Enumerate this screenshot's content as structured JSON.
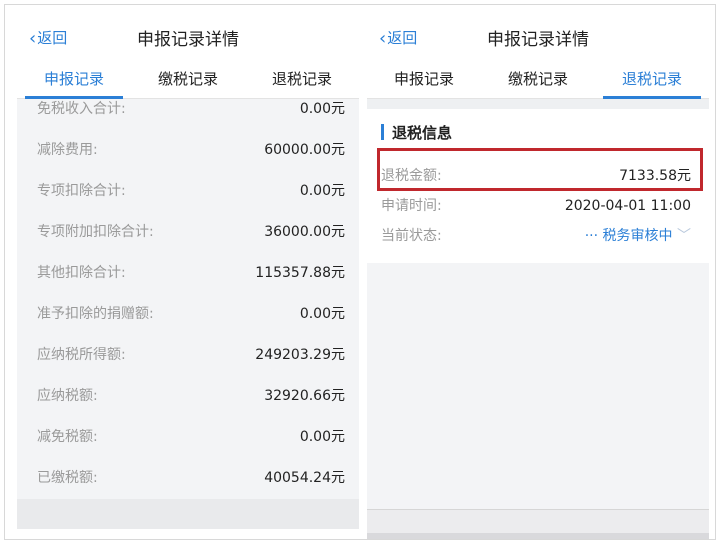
{
  "left": {
    "back_label": "返回",
    "title": "申报记录详情",
    "tabs": [
      {
        "label": "申报记录",
        "active": true
      },
      {
        "label": "缴税记录",
        "active": false
      },
      {
        "label": "退税记录",
        "active": false
      }
    ],
    "rows": [
      {
        "label": "免税收入合计:",
        "value": "0.00元"
      },
      {
        "label": "减除费用:",
        "value": "60000.00元"
      },
      {
        "label": "专项扣除合计:",
        "value": "0.00元"
      },
      {
        "label": "专项附加扣除合计:",
        "value": "36000.00元"
      },
      {
        "label": "其他扣除合计:",
        "value": "115357.88元"
      },
      {
        "label": "准予扣除的捐赠额:",
        "value": "0.00元"
      },
      {
        "label": "应纳税所得额:",
        "value": "249203.29元"
      },
      {
        "label": "应纳税额:",
        "value": "32920.66元"
      },
      {
        "label": "减免税额:",
        "value": "0.00元"
      },
      {
        "label": "已缴税额:",
        "value": "40054.24元"
      }
    ]
  },
  "right": {
    "back_label": "返回",
    "title": "申报记录详情",
    "tabs": [
      {
        "label": "申报记录",
        "active": false
      },
      {
        "label": "缴税记录",
        "active": false
      },
      {
        "label": "退税记录",
        "active": true
      }
    ],
    "section_title": "退税信息",
    "refund_amount_label": "退税金额:",
    "refund_amount_value": "7133.58元",
    "apply_time_label": "申请时间:",
    "apply_time_value": "2020-04-01 11:00",
    "status_label": "当前状态:",
    "status_value": "税务审核中"
  },
  "colors": {
    "accent": "#2b7fd6",
    "highlight": "#c0282d"
  }
}
